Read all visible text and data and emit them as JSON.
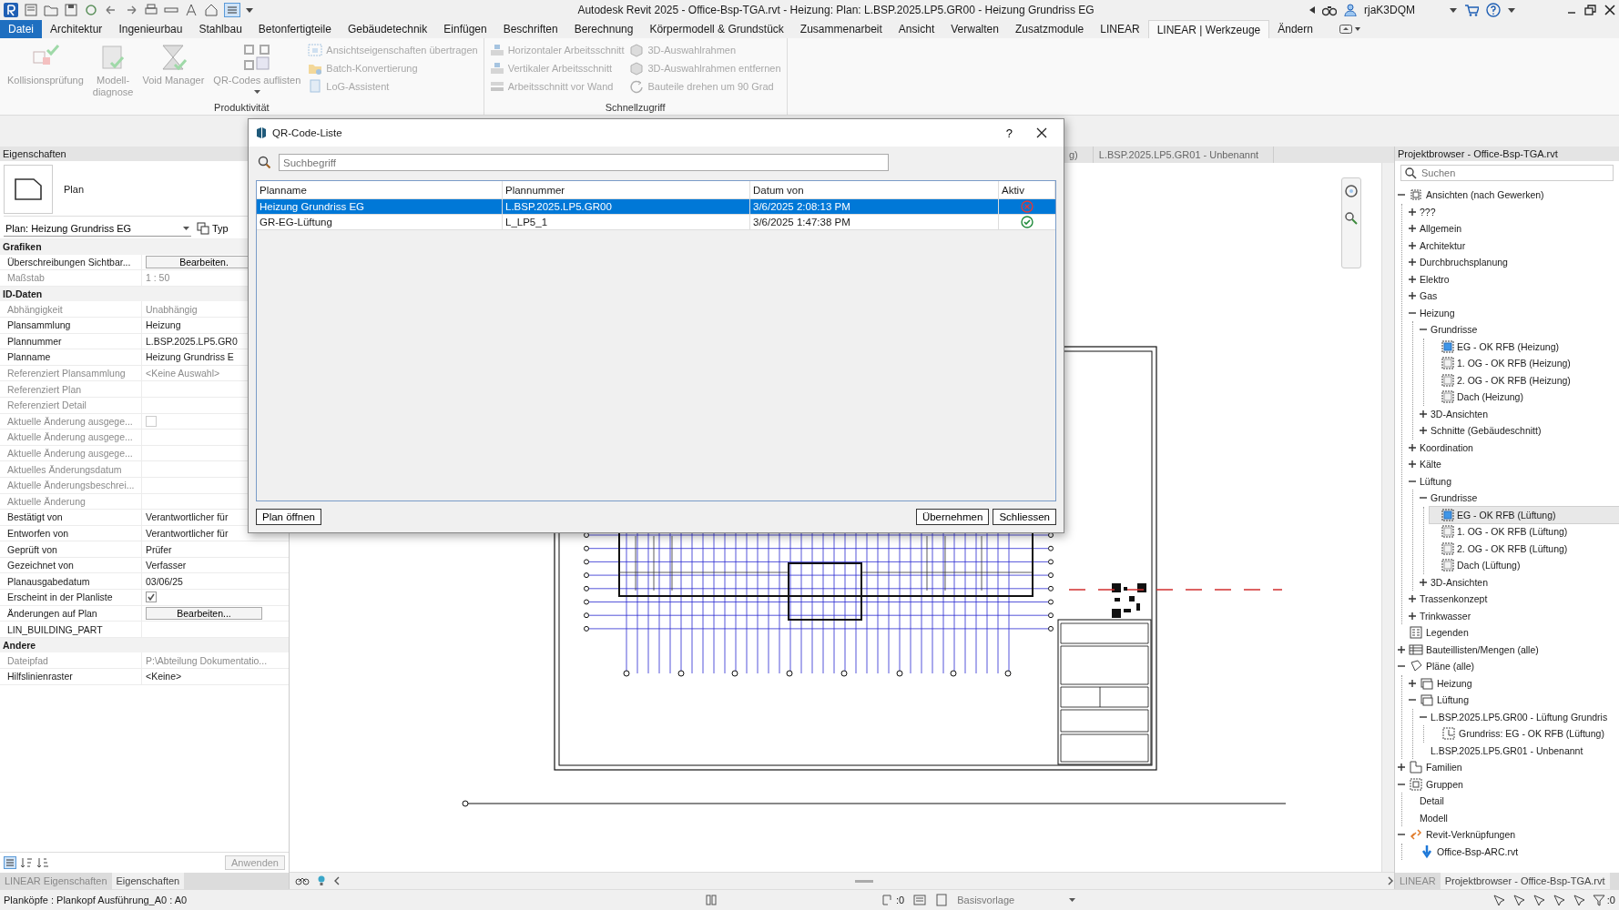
{
  "title_bar": {
    "title": "Autodesk Revit 2025 - Office-Bsp-TGA.rvt - Heizung: Plan: L.BSP.2025.LP5.GR00 - Heizung Grundriss EG",
    "user": "rjaK3DQM"
  },
  "ribbon_tabs": [
    {
      "label": "Datei",
      "kind": "file",
      "selected": false
    },
    {
      "label": "Architektur",
      "kind": "tab",
      "selected": false
    },
    {
      "label": "Ingenieurbau",
      "kind": "tab",
      "selected": false
    },
    {
      "label": "Stahlbau",
      "kind": "tab",
      "selected": false
    },
    {
      "label": "Betonfertigteile",
      "kind": "tab",
      "selected": false
    },
    {
      "label": "Gebäudetechnik",
      "kind": "tab",
      "selected": false
    },
    {
      "label": "Einfügen",
      "kind": "tab",
      "selected": false
    },
    {
      "label": "Beschriften",
      "kind": "tab",
      "selected": false
    },
    {
      "label": "Berechnung",
      "kind": "tab",
      "selected": false
    },
    {
      "label": "Körpermodell & Grundstück",
      "kind": "tab",
      "selected": false
    },
    {
      "label": "Zusammenarbeit",
      "kind": "tab",
      "selected": false
    },
    {
      "label": "Ansicht",
      "kind": "tab",
      "selected": false
    },
    {
      "label": "Verwalten",
      "kind": "tab",
      "selected": false
    },
    {
      "label": "Zusatzmodule",
      "kind": "tab",
      "selected": false
    },
    {
      "label": "LINEAR",
      "kind": "tab",
      "selected": false
    },
    {
      "label": "LINEAR | Werkzeuge",
      "kind": "tab",
      "selected": true
    },
    {
      "label": "Ändern",
      "kind": "tab",
      "selected": false
    }
  ],
  "ribbon_panels": [
    {
      "title": "Produktivität",
      "large_buttons": [
        {
          "label": "Kollisionsprüfung",
          "disabled": true,
          "dropdown": false
        },
        {
          "label": "Modell-\ndiagnose",
          "disabled": true,
          "dropdown": false
        },
        {
          "label": "Void Manager",
          "disabled": true,
          "dropdown": false
        },
        {
          "label": "QR-Codes auflisten",
          "disabled": true,
          "dropdown": true
        }
      ],
      "small_columns": [
        [
          {
            "label": "Ansichtseigenschaften übertragen",
            "disabled": true
          },
          {
            "label": "Batch-Konvertierung",
            "disabled": true
          },
          {
            "label": "LoG-Assistent",
            "disabled": true
          }
        ]
      ]
    },
    {
      "title": "Schnellzugriff",
      "small_columns": [
        [
          {
            "label": "Horizontaler Arbeitsschnitt",
            "disabled": true
          },
          {
            "label": "Vertikaler Arbeitsschnitt",
            "disabled": true
          },
          {
            "label": "Arbeitsschnitt vor Wand",
            "disabled": true
          }
        ],
        [
          {
            "label": "3D-Auswahlrahmen",
            "disabled": true
          },
          {
            "label": "3D-Auswahlrahmen entfernen",
            "disabled": true
          },
          {
            "label": "Bauteile drehen um 90 Grad",
            "disabled": true
          }
        ]
      ]
    }
  ],
  "properties": {
    "title": "Eigenschaften",
    "type_name": "Plan",
    "selector": "Plan: Heizung Grundriss EG",
    "type_button": "Typ",
    "groups": [
      {
        "title": "Grafiken",
        "rows": [
          {
            "label": "Überschreibungen Sichtbar...",
            "value": "Bearbeiten.",
            "kind": "button",
            "disabled": false
          },
          {
            "label": "Maßstab",
            "value": "1 : 50",
            "kind": "text",
            "disabled": true
          }
        ]
      },
      {
        "title": "ID-Daten",
        "rows": [
          {
            "label": "Abhängigkeit",
            "value": "Unabhängig",
            "kind": "text",
            "disabled": true
          },
          {
            "label": "Plansammlung",
            "value": "Heizung",
            "kind": "text",
            "disabled": false
          },
          {
            "label": "Plannummer",
            "value": "L.BSP.2025.LP5.GR0",
            "kind": "text",
            "disabled": false
          },
          {
            "label": "Planname",
            "value": "Heizung Grundriss E",
            "kind": "text",
            "disabled": false
          },
          {
            "label": "Referenziert Plansammlung",
            "value": "<Keine Auswahl>",
            "kind": "text",
            "disabled": true
          },
          {
            "label": "Referenziert Plan",
            "kind": "text",
            "disabled": true
          },
          {
            "label": "Referenziert Detail",
            "kind": "text",
            "disabled": true
          },
          {
            "label": "Aktuelle Änderung ausgege...",
            "kind": "checkbox",
            "checked": false,
            "disabled": true
          },
          {
            "label": "Aktuelle Änderung ausgege...",
            "kind": "text",
            "disabled": true
          },
          {
            "label": "Aktuelle Änderung ausgege...",
            "kind": "text",
            "disabled": true
          },
          {
            "label": "Aktuelles Änderungsdatum",
            "kind": "text",
            "disabled": true
          },
          {
            "label": "Aktuelle Änderungsbeschrei...",
            "kind": "text",
            "disabled": true
          },
          {
            "label": "Aktuelle Änderung",
            "kind": "text",
            "disabled": true
          },
          {
            "label": "Bestätigt von",
            "value": "Verantwortlicher für",
            "kind": "text",
            "disabled": false
          },
          {
            "label": "Entworfen von",
            "value": "Verantwortlicher für",
            "kind": "text",
            "disabled": false
          },
          {
            "label": "Geprüft von",
            "value": "Prüfer",
            "kind": "text",
            "disabled": false
          },
          {
            "label": "Gezeichnet von",
            "value": "Verfasser",
            "kind": "text",
            "disabled": false
          },
          {
            "label": "Planausgabedatum",
            "value": "03/06/25",
            "kind": "text",
            "disabled": false
          },
          {
            "label": "Erscheint in der Planliste",
            "kind": "checkbox",
            "checked": true,
            "disabled": false
          },
          {
            "label": "Änderungen auf Plan",
            "value": "Bearbeiten...",
            "kind": "button",
            "disabled": false
          },
          {
            "label": "LIN_BUILDING_PART",
            "kind": "text",
            "disabled": false
          }
        ]
      },
      {
        "title": "Andere",
        "rows": [
          {
            "label": "Dateipfad",
            "value": "P:\\Abteilung Dokumentatio...",
            "kind": "text",
            "disabled": true
          },
          {
            "label": "Hilfslinienraster",
            "value": "<Keine>",
            "kind": "text",
            "disabled": false
          }
        ]
      }
    ],
    "apply_button": {
      "label": "Anwenden",
      "disabled": true
    },
    "tabs": [
      {
        "label": "LINEAR Eigenschaften",
        "selected": false
      },
      {
        "label": "Eigenschaften",
        "selected": true
      }
    ]
  },
  "view_tabs": [
    {
      "label": "g)",
      "selected": false
    },
    {
      "label": "L.BSP.2025.LP5.GR01 - Unbenannt",
      "selected": false
    }
  ],
  "dialog": {
    "title": "QR-Code-Liste",
    "help": "?",
    "search_placeholder": "Suchbegriff",
    "columns": [
      "Planname",
      "Plannummer",
      "Datum von",
      "Aktiv"
    ],
    "rows": [
      {
        "planname": "Heizung Grundriss EG",
        "plannummer": "L.BSP.2025.LP5.GR00",
        "datum": "3/6/2025 2:08:13 PM",
        "active": false,
        "selected": true
      },
      {
        "planname": "GR-EG-Lüftung",
        "plannummer": "L_LP5_1",
        "datum": "3/6/2025 1:47:38 PM",
        "active": true,
        "selected": false
      }
    ],
    "buttons_left": [
      "Plan öffnen"
    ],
    "buttons_right": [
      "Übernehmen",
      "Schliessen"
    ]
  },
  "project_browser": {
    "title": "Projektbrowser - Office-Bsp-TGA.rvt",
    "search_placeholder": "Suchen",
    "tree": [
      {
        "label": "Ansichten (nach Gewerken)",
        "kind": "views",
        "expanded": true,
        "selected": false,
        "children": [
          {
            "label": "???",
            "expanded": false,
            "selected": false
          },
          {
            "label": "Allgemein",
            "expanded": false,
            "selected": false
          },
          {
            "label": "Architektur",
            "expanded": false,
            "selected": false
          },
          {
            "label": "Durchbruchsplanung",
            "expanded": false,
            "selected": false
          },
          {
            "label": "Elektro",
            "expanded": false,
            "selected": false
          },
          {
            "label": "Gas",
            "expanded": false,
            "selected": false
          },
          {
            "label": "Heizung",
            "expanded": true,
            "selected": false,
            "children": [
              {
                "label": "Grundrisse",
                "expanded": true,
                "selected": false,
                "children": [
                  {
                    "label": "EG - OK RFB (Heizung)",
                    "kind": "view",
                    "open": true,
                    "selected": false
                  },
                  {
                    "label": "1. OG - OK RFB (Heizung)",
                    "kind": "view",
                    "open": false,
                    "selected": false
                  },
                  {
                    "label": "2. OG - OK RFB (Heizung)",
                    "kind": "view",
                    "open": false,
                    "selected": false
                  },
                  {
                    "label": "Dach (Heizung)",
                    "kind": "view",
                    "open": false,
                    "selected": false
                  }
                ]
              },
              {
                "label": "3D-Ansichten",
                "expanded": false,
                "selected": false
              },
              {
                "label": "Schnitte (Gebäudeschnitt)",
                "expanded": false,
                "selected": false
              }
            ]
          },
          {
            "label": "Koordination",
            "expanded": false,
            "selected": false
          },
          {
            "label": "Kälte",
            "expanded": false,
            "selected": false
          },
          {
            "label": "Lüftung",
            "expanded": true,
            "selected": false,
            "children": [
              {
                "label": "Grundrisse",
                "expanded": true,
                "selected": false,
                "children": [
                  {
                    "label": "EG - OK RFB (Lüftung)",
                    "kind": "view",
                    "open": true,
                    "selected": true
                  },
                  {
                    "label": "1. OG - OK RFB (Lüftung)",
                    "kind": "view",
                    "open": false,
                    "selected": false
                  },
                  {
                    "label": "2. OG - OK RFB (Lüftung)",
                    "kind": "view",
                    "open": false,
                    "selected": false
                  },
                  {
                    "label": "Dach (Lüftung)",
                    "kind": "view",
                    "open": false,
                    "selected": false
                  }
                ]
              },
              {
                "label": "3D-Ansichten",
                "expanded": false,
                "selected": false
              }
            ]
          },
          {
            "label": "Trassenkonzept",
            "expanded": false,
            "selected": false
          },
          {
            "label": "Trinkwasser",
            "expanded": false,
            "selected": false
          }
        ]
      },
      {
        "label": "Legenden",
        "kind": "legend",
        "selected": false
      },
      {
        "label": "Bauteillisten/Mengen (alle)",
        "kind": "schedule",
        "expanded": false,
        "selected": false
      },
      {
        "label": "Pläne (alle)",
        "kind": "sheets",
        "expanded": true,
        "selected": false,
        "children": [
          {
            "label": "Heizung",
            "kind": "sheetset",
            "expanded": false,
            "selected": false
          },
          {
            "label": "Lüftung",
            "kind": "sheetset",
            "expanded": true,
            "selected": false,
            "children": [
              {
                "label": "L.BSP.2025.LP5.GR00 - Lüftung Grundris",
                "expanded": true,
                "selected": false,
                "children": [
                  {
                    "label": "Grundriss: EG - OK RFB (Lüftung)",
                    "kind": "sheetview",
                    "selected": false
                  }
                ]
              },
              {
                "label": "L.BSP.2025.LP5.GR01 - Unbenannt",
                "selected": false
              }
            ]
          }
        ]
      },
      {
        "label": "Familien",
        "kind": "family",
        "expanded": false,
        "selected": false
      },
      {
        "label": "Gruppen",
        "kind": "group",
        "expanded": true,
        "selected": false,
        "children": [
          {
            "label": "Detail",
            "selected": false
          },
          {
            "label": "Modell",
            "selected": false
          }
        ]
      },
      {
        "label": "Revit-Verknüpfungen",
        "kind": "link",
        "expanded": true,
        "selected": false,
        "children": [
          {
            "label": "Office-Bsp-ARC.rvt",
            "kind": "linkfile",
            "selected": false
          }
        ]
      }
    ],
    "tabs": [
      {
        "label": "LINEAR",
        "selected": false
      },
      {
        "label": "Projektbrowser - Office-Bsp-TGA.rvt",
        "selected": true
      }
    ]
  },
  "status_bar": {
    "text": "Planköpfe : Plankopf Ausführung_A0 : A0",
    "selection_count": ":0",
    "workset": "Basisvorlage",
    "filter_count": ":0"
  }
}
